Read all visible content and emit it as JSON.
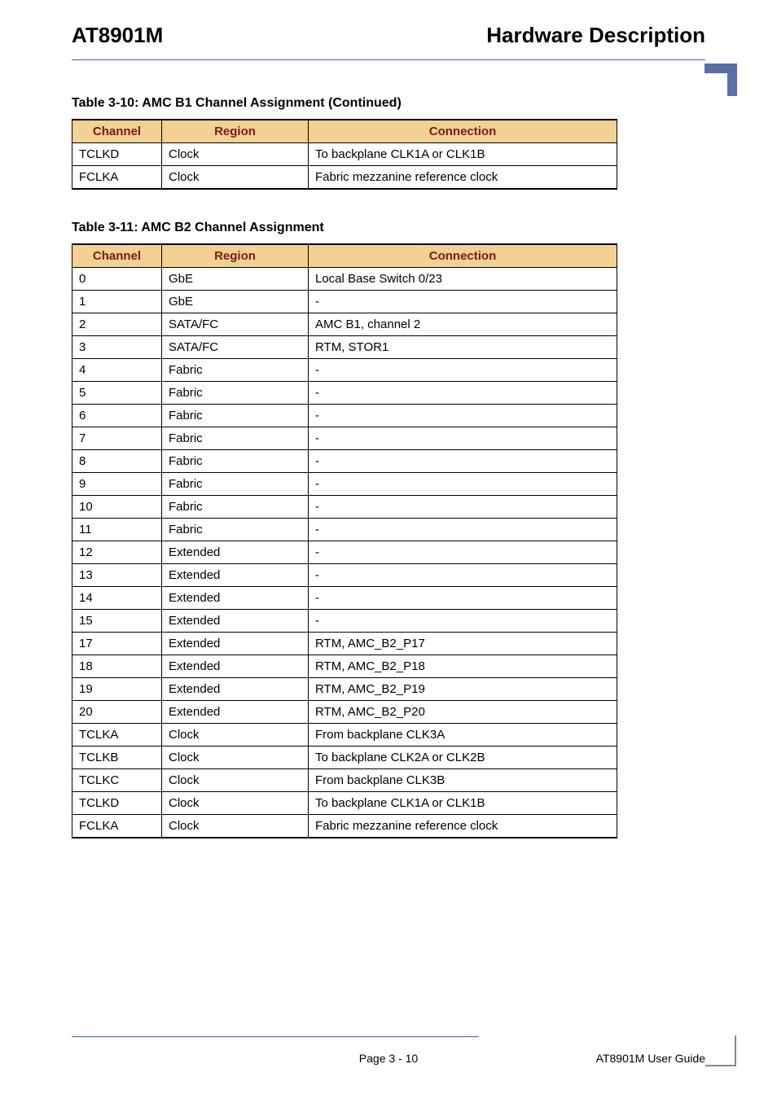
{
  "header": {
    "left": "AT8901M",
    "right": "Hardware Description"
  },
  "table1": {
    "caption": "Table 3-10:  AMC B1 Channel Assignment  (Continued)",
    "headers": {
      "channel": "Channel",
      "region": "Region",
      "connection": "Connection"
    },
    "rows": [
      {
        "channel": "TCLKD",
        "region": "Clock",
        "connection": "To backplane CLK1A or CLK1B"
      },
      {
        "channel": "FCLKA",
        "region": "Clock",
        "connection": "Fabric mezzanine reference clock"
      }
    ]
  },
  "table2": {
    "caption": "Table 3-11:  AMC B2 Channel Assignment",
    "headers": {
      "channel": "Channel",
      "region": "Region",
      "connection": "Connection"
    },
    "rows": [
      {
        "channel": "0",
        "region": "GbE",
        "connection": "Local Base Switch 0/23"
      },
      {
        "channel": "1",
        "region": "GbE",
        "connection": "-"
      },
      {
        "channel": "2",
        "region": "SATA/FC",
        "connection": "AMC B1, channel 2"
      },
      {
        "channel": "3",
        "region": "SATA/FC",
        "connection": "RTM, STOR1"
      },
      {
        "channel": "4",
        "region": "Fabric",
        "connection": "-"
      },
      {
        "channel": "5",
        "region": "Fabric",
        "connection": "-"
      },
      {
        "channel": "6",
        "region": "Fabric",
        "connection": "-"
      },
      {
        "channel": "7",
        "region": "Fabric",
        "connection": "-"
      },
      {
        "channel": "8",
        "region": "Fabric",
        "connection": "-"
      },
      {
        "channel": "9",
        "region": "Fabric",
        "connection": "-"
      },
      {
        "channel": "10",
        "region": "Fabric",
        "connection": "-"
      },
      {
        "channel": "11",
        "region": "Fabric",
        "connection": "-"
      },
      {
        "channel": "12",
        "region": "Extended",
        "connection": "-"
      },
      {
        "channel": "13",
        "region": "Extended",
        "connection": "-"
      },
      {
        "channel": "14",
        "region": "Extended",
        "connection": "-"
      },
      {
        "channel": "15",
        "region": "Extended",
        "connection": "-"
      },
      {
        "channel": "17",
        "region": "Extended",
        "connection": "RTM, AMC_B2_P17"
      },
      {
        "channel": "18",
        "region": "Extended",
        "connection": "RTM, AMC_B2_P18"
      },
      {
        "channel": "19",
        "region": "Extended",
        "connection": "RTM, AMC_B2_P19"
      },
      {
        "channel": "20",
        "region": "Extended",
        "connection": "RTM, AMC_B2_P20"
      },
      {
        "channel": "TCLKA",
        "region": "Clock",
        "connection": "From backplane CLK3A"
      },
      {
        "channel": "TCLKB",
        "region": "Clock",
        "connection": "To backplane CLK2A or CLK2B"
      },
      {
        "channel": "TCLKC",
        "region": "Clock",
        "connection": "From backplane CLK3B"
      },
      {
        "channel": "TCLKD",
        "region": "Clock",
        "connection": "To backplane CLK1A or CLK1B"
      },
      {
        "channel": "FCLKA",
        "region": "Clock",
        "connection": "Fabric mezzanine reference clock"
      }
    ]
  },
  "footer": {
    "center": "Page 3 - 10",
    "right": "AT8901M User Guide"
  }
}
